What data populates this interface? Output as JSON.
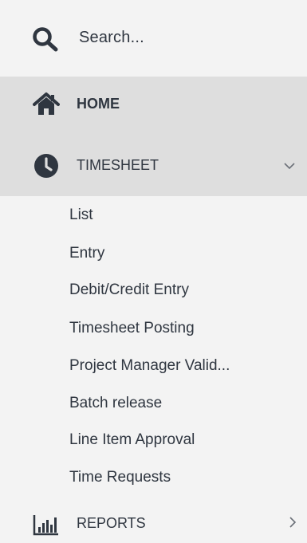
{
  "search": {
    "placeholder": "Search...",
    "icon": "search-icon"
  },
  "nav": {
    "home": {
      "label": "HOME",
      "icon": "home-icon"
    },
    "timesheet": {
      "label": "TIMESHEET",
      "icon": "clock-icon",
      "expanded": true,
      "items": [
        {
          "label": "List"
        },
        {
          "label": "Entry"
        },
        {
          "label": "Debit/Credit Entry"
        },
        {
          "label": "Timesheet Posting"
        },
        {
          "label": "Project Manager Valid..."
        },
        {
          "label": "Batch release"
        },
        {
          "label": "Line Item Approval"
        },
        {
          "label": "Time Requests"
        }
      ]
    },
    "reports": {
      "label": "REPORTS",
      "icon": "bar-chart-icon"
    }
  },
  "colors": {
    "background": "#f3f3f3",
    "active_background": "#dedede",
    "text": "#2f3640",
    "icon": "#2f3640"
  }
}
